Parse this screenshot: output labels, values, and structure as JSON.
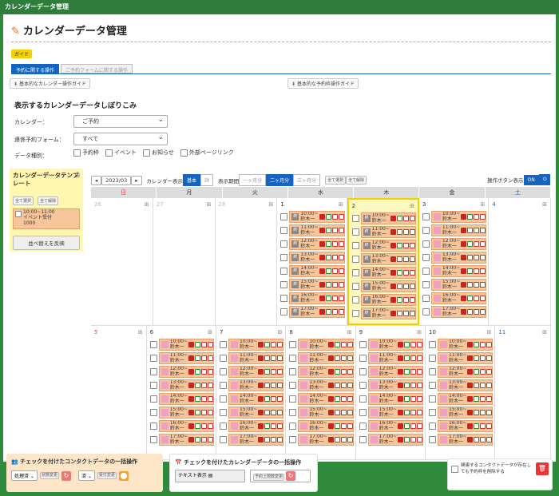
{
  "window": {
    "title": "カレンダーデータ管理"
  },
  "page": {
    "title": "カレンダーデータ管理",
    "guide": "ガイド"
  },
  "tabs": [
    {
      "label": "予約に関する操作"
    },
    {
      "label": "ご予約フォームに関する操作"
    }
  ],
  "guides": {
    "basic_calendar": "基本的なカレンダー操作ガイド",
    "basic_booking": "基本的な予約枠操作ガイド"
  },
  "filter": {
    "title": "表示するカレンダーデータしぼりこみ",
    "calendar_label": "カレンダー：",
    "calendar_value": "ご予約",
    "form_label": "連係予約フォーム：",
    "form_value": "すべて",
    "type_label": "データ種別：",
    "types": [
      "予約枠",
      "イベント",
      "お知らせ",
      "外部ページリンク"
    ]
  },
  "template": {
    "title": "カレンダーデータテンプレート",
    "select_all": "全て選択",
    "deselect_all": "全て解除",
    "item_time": "10:00~11:00",
    "item_name": "イベント受付",
    "item_count": "1000",
    "reflect": "並べ替えを反映"
  },
  "toolbar": {
    "month": "2023/03",
    "cal_display": "カレンダー表示",
    "basic": "基本",
    "detail": "詳",
    "display_period": "表示期間",
    "one_month": "一ヶ月分",
    "two_month": "二ヶ月分",
    "three_month": "三ヶ月分",
    "select_all": "全て選択",
    "deselect_all": "全て解除",
    "op_button": "操作ボタン表示",
    "on": "ON"
  },
  "calendar": {
    "weekdays": [
      "日",
      "月",
      "火",
      "水",
      "木",
      "金",
      "土"
    ],
    "weeks": [
      [
        {
          "d": "26",
          "c": "gray"
        },
        {
          "d": "27",
          "c": "gray"
        },
        {
          "d": "28",
          "c": "gray"
        },
        {
          "d": "1",
          "c": "",
          "e": true,
          "g": true
        },
        {
          "d": "2",
          "c": "",
          "e": true,
          "g": true,
          "today": true
        },
        {
          "d": "3",
          "c": "",
          "e": true
        },
        {
          "d": "4",
          "c": "blue"
        }
      ],
      [
        {
          "d": "5",
          "c": "red"
        },
        {
          "d": "6",
          "c": "",
          "e": true
        },
        {
          "d": "7",
          "c": "",
          "e": true
        },
        {
          "d": "8",
          "c": "",
          "e": true
        },
        {
          "d": "9",
          "c": "",
          "e": true
        },
        {
          "d": "10",
          "c": "",
          "e": true
        },
        {
          "d": "11",
          "c": "blue"
        }
      ]
    ],
    "times": [
      "10:00~",
      "11:00~",
      "12:00~",
      "13:00~",
      "14:00~",
      "15:00~",
      "16:00~",
      "17:00~"
    ],
    "person": "鈴木一",
    "stamp": "終"
  },
  "bottom": {
    "contact_title": "チェックを付けたコンタクトデータの一括操作",
    "status_select": "処理済",
    "status_btn": "状態変更",
    "done_select": "済",
    "receipt_btn": "受付変更",
    "cal_title": "チェックを付けたカレンダーデータの一括操作",
    "text_display": "テキスト表示",
    "booking_change": "予約上限数変更",
    "delete_text": "関連するコンタクトデータが存在しても予約枠を削除する"
  }
}
